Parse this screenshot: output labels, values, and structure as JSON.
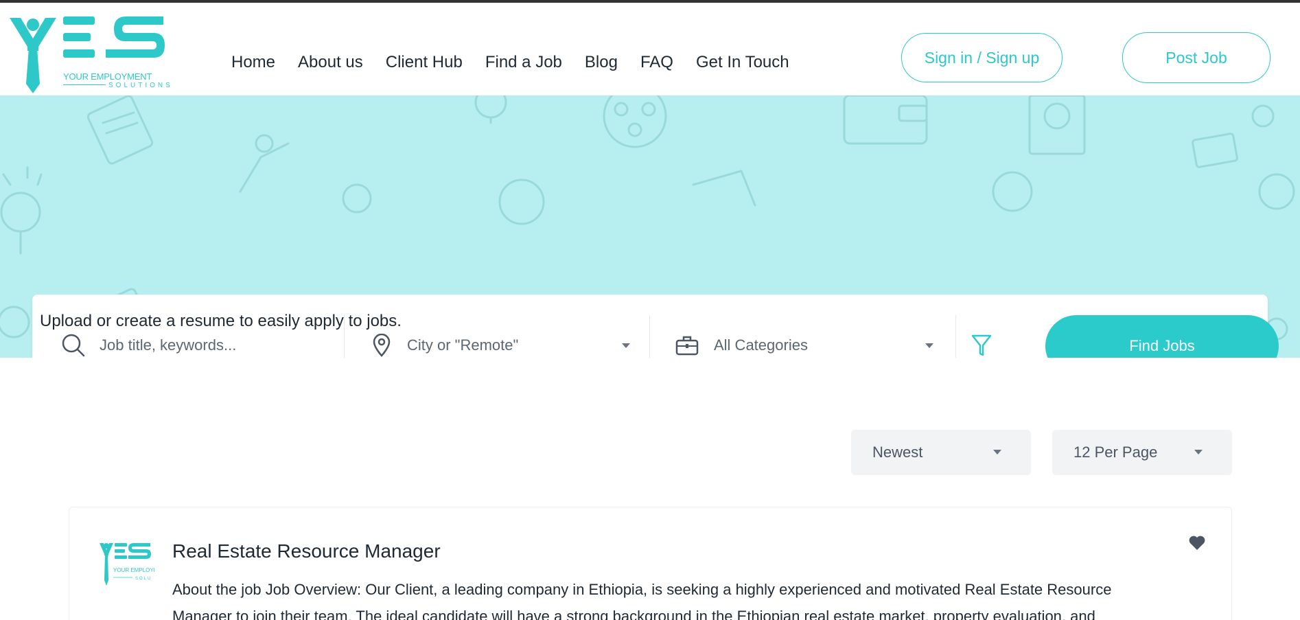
{
  "brand": {
    "logo_text": "YES",
    "tagline_line1": "YOUR EMPLOYMENT",
    "tagline_line2": "SOLUTIONS",
    "accent_color": "#2ec8c8",
    "hero_color": "#b7eff0"
  },
  "nav": {
    "items": [
      {
        "label": "Home"
      },
      {
        "label": "About us"
      },
      {
        "label": "Client Hub"
      },
      {
        "label": "Find a Job"
      },
      {
        "label": "Blog"
      },
      {
        "label": "FAQ"
      },
      {
        "label": "Get In Touch"
      }
    ]
  },
  "header_buttons": {
    "signin_label": "Sign in / Sign up",
    "post_label": "Post Job"
  },
  "search": {
    "keywords_placeholder": "Job title, keywords...",
    "location_placeholder": "City or \"Remote\"",
    "category_value": "All Categories",
    "find_label": "Find Jobs",
    "icons": {
      "keywords": "search-icon",
      "location": "map-pin-icon",
      "category": "briefcase-icon",
      "filter": "filter-icon"
    }
  },
  "hero": {
    "upload_note": "Upload or create a resume to easily apply to jobs."
  },
  "sort": {
    "order_value": "Newest",
    "per_page_value": "12 Per Page"
  },
  "jobs": [
    {
      "title": "Real Estate Resource Manager",
      "description": "About the job   Job Overview: Our Client, a leading company in Ethiopia, is seeking a highly experienced and motivated Real Estate Resource Manager to join their team. The ideal candidate will have a strong background in the Ethiopian real estate market, property evaluation, and",
      "favorite_icon": "heart-icon"
    }
  ]
}
